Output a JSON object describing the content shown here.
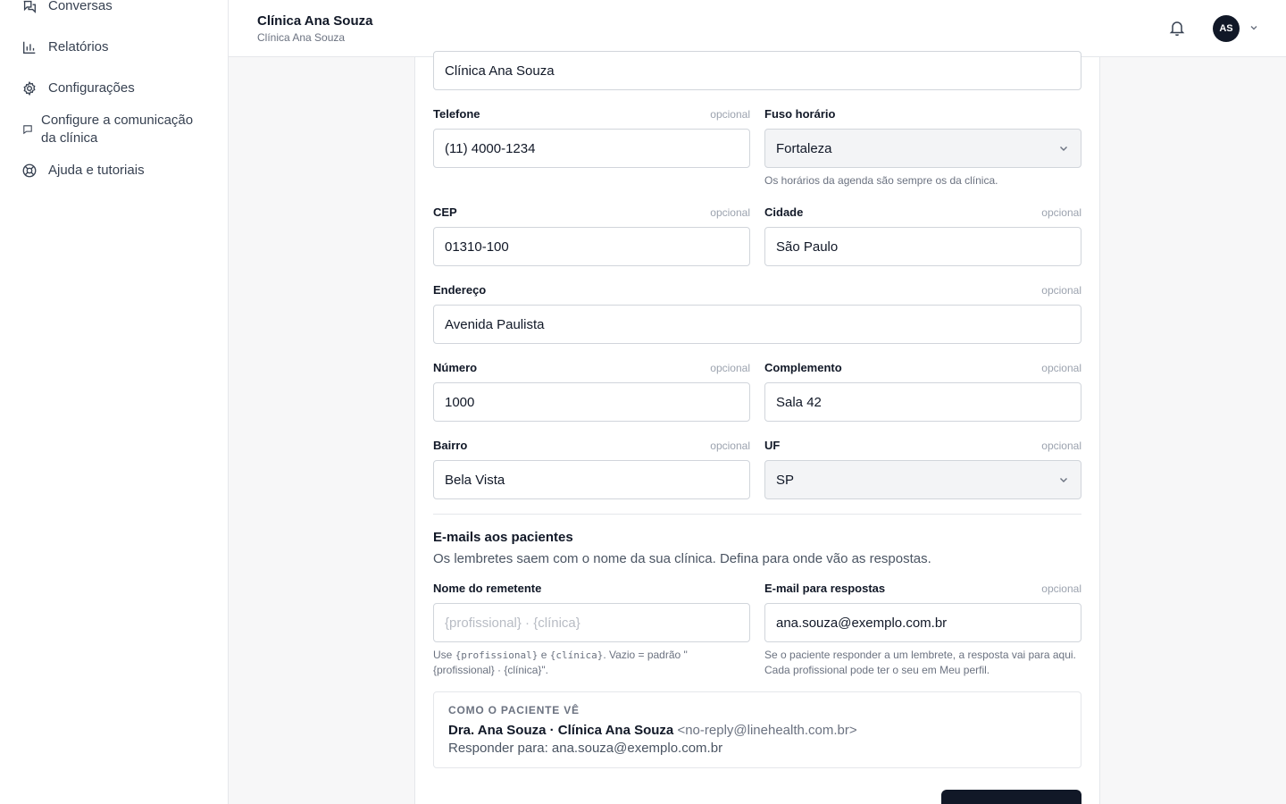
{
  "sidebar": {
    "items": [
      {
        "label": "Conversas",
        "icon": "chat-icon"
      },
      {
        "label": "Relatórios",
        "icon": "bar-chart-icon"
      },
      {
        "label": "Configurações",
        "icon": "gear-icon"
      },
      {
        "label": "Configure a comunicação da clínica",
        "icon": "message-square-icon"
      },
      {
        "label": "Ajuda e tutoriais",
        "icon": "lifebuoy-icon"
      }
    ]
  },
  "header": {
    "title": "Clínica Ana Souza",
    "subtitle": "Clínica Ana Souza",
    "avatar_initials": "AS"
  },
  "form": {
    "optional_label": "opcional",
    "clinic_name": {
      "value": "Clínica Ana Souza"
    },
    "telefone": {
      "label": "Telefone",
      "value": "(11) 4000-1234"
    },
    "fuso": {
      "label": "Fuso horário",
      "value": "Fortaleza",
      "hint": "Os horários da agenda são sempre os da clínica."
    },
    "cep": {
      "label": "CEP",
      "value": "01310-100"
    },
    "cidade": {
      "label": "Cidade",
      "value": "São Paulo"
    },
    "endereco": {
      "label": "Endereço",
      "value": "Avenida Paulista"
    },
    "numero": {
      "label": "Número",
      "value": "1000"
    },
    "complemento": {
      "label": "Complemento",
      "value": "Sala 42"
    },
    "bairro": {
      "label": "Bairro",
      "value": "Bela Vista"
    },
    "uf": {
      "label": "UF",
      "value": "SP"
    }
  },
  "emails": {
    "title": "E-mails aos pacientes",
    "description": "Os lembretes saem com o nome da sua clínica. Defina para onde vão as respostas.",
    "sender": {
      "label": "Nome do remetente",
      "placeholder": "{profissional} · {clínica}",
      "hint_use": "Use ",
      "hint_code1": "{profissional}",
      "hint_and": " e ",
      "hint_code2": "{clínica}",
      "hint_rest": ". Vazio = padrão \"{profissional} · {clínica}\"."
    },
    "reply": {
      "label": "E-mail para respostas",
      "value": "ana.souza@exemplo.com.br",
      "hint": "Se o paciente responder a um lembrete, a resposta vai para aqui. Cada profissional pode ter o seu em Meu perfil."
    },
    "preview": {
      "caption": "COMO O PACIENTE VÊ",
      "from_name": "Dra. Ana Souza · Clínica Ana Souza",
      "from_address": "<no-reply@linehealth.com.br>",
      "reply_to": "Responder para: ana.souza@exemplo.com.br"
    }
  },
  "colors": {
    "primary": "#111827",
    "border": "#e5e7eb",
    "muted": "#6b7280",
    "background": "#f7f7f8"
  }
}
